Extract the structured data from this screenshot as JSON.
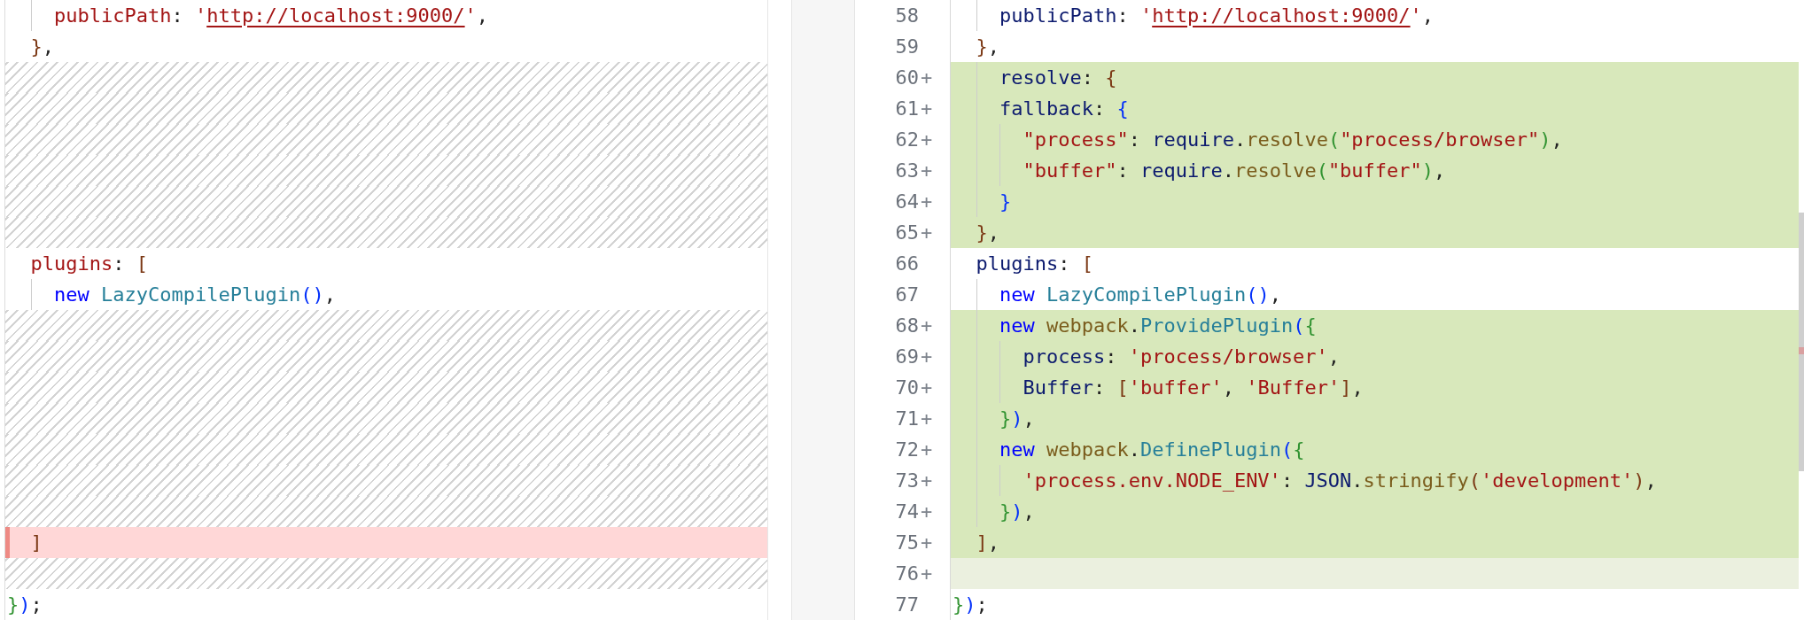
{
  "left_pane": {
    "lines": [
      {
        "kind": "code",
        "tokens": [
          {
            "kind": "name",
            "text": "    publicPath"
          },
          {
            "kind": "text",
            "text": ": "
          },
          {
            "kind": "string",
            "text": "'"
          },
          {
            "kind": "link",
            "text": "http://localhost:9000/"
          },
          {
            "kind": "string",
            "text": "'"
          },
          {
            "kind": "text",
            "text": ","
          }
        ]
      },
      {
        "kind": "code",
        "tokens": [
          {
            "kind": "brace1",
            "text": "  }"
          },
          {
            "kind": "text",
            "text": ","
          }
        ]
      },
      {
        "kind": "filler"
      },
      {
        "kind": "filler"
      },
      {
        "kind": "filler"
      },
      {
        "kind": "filler"
      },
      {
        "kind": "filler"
      },
      {
        "kind": "filler"
      },
      {
        "kind": "code",
        "tokens": [
          {
            "kind": "name",
            "text": "  plugins"
          },
          {
            "kind": "text",
            "text": ": "
          },
          {
            "kind": "brace1",
            "text": "["
          }
        ]
      },
      {
        "kind": "code",
        "tokens": [
          {
            "kind": "keyword",
            "text": "    new"
          },
          {
            "kind": "class",
            "text": " LazyCompilePlugin"
          },
          {
            "kind": "brace2",
            "text": "()"
          },
          {
            "kind": "text",
            "text": ","
          }
        ]
      },
      {
        "kind": "filler"
      },
      {
        "kind": "filler"
      },
      {
        "kind": "filler"
      },
      {
        "kind": "filler"
      },
      {
        "kind": "filler"
      },
      {
        "kind": "filler"
      },
      {
        "kind": "filler"
      },
      {
        "kind": "deleted",
        "tokens": [
          {
            "kind": "brace1",
            "text": "  ]"
          }
        ]
      },
      {
        "kind": "filler"
      },
      {
        "kind": "code",
        "tokens": [
          {
            "kind": "brace3",
            "text": "}"
          },
          {
            "kind": "brace2",
            "text": ")"
          },
          {
            "kind": "text",
            "text": ";"
          }
        ]
      }
    ]
  },
  "right_pane": {
    "lines": [
      {
        "number": "58",
        "kind": "context",
        "tokens": [
          {
            "kind": "ident",
            "text": "    publicPath"
          },
          {
            "kind": "text",
            "text": ": "
          },
          {
            "kind": "string",
            "text": "'"
          },
          {
            "kind": "link",
            "text": "http://localhost:9000/"
          },
          {
            "kind": "string",
            "text": "'"
          },
          {
            "kind": "text",
            "text": ","
          }
        ]
      },
      {
        "number": "59",
        "kind": "context",
        "tokens": [
          {
            "kind": "brace1",
            "text": "  }"
          },
          {
            "kind": "text",
            "text": ","
          }
        ]
      },
      {
        "number": "60",
        "marker": "+",
        "kind": "added",
        "tokens": [
          {
            "kind": "ident",
            "text": "    resolve"
          },
          {
            "kind": "text",
            "text": ": "
          },
          {
            "kind": "brace1",
            "text": "{"
          }
        ]
      },
      {
        "number": "61",
        "marker": "+",
        "kind": "added",
        "tokens": [
          {
            "kind": "ident",
            "text": "    fallback"
          },
          {
            "kind": "text",
            "text": ": "
          },
          {
            "kind": "brace2",
            "text": "{"
          }
        ]
      },
      {
        "number": "62",
        "marker": "+",
        "kind": "added",
        "tokens": [
          {
            "kind": "string",
            "text": "      \"process\""
          },
          {
            "kind": "text",
            "text": ": "
          },
          {
            "kind": "ident",
            "text": "require"
          },
          {
            "kind": "text",
            "text": "."
          },
          {
            "kind": "method",
            "text": "resolve"
          },
          {
            "kind": "brace3",
            "text": "("
          },
          {
            "kind": "string",
            "text": "\"process/browser\""
          },
          {
            "kind": "brace3",
            "text": ")"
          },
          {
            "kind": "text",
            "text": ","
          }
        ]
      },
      {
        "number": "63",
        "marker": "+",
        "kind": "added",
        "tokens": [
          {
            "kind": "string",
            "text": "      \"buffer\""
          },
          {
            "kind": "text",
            "text": ": "
          },
          {
            "kind": "ident",
            "text": "require"
          },
          {
            "kind": "text",
            "text": "."
          },
          {
            "kind": "method",
            "text": "resolve"
          },
          {
            "kind": "brace3",
            "text": "("
          },
          {
            "kind": "string",
            "text": "\"buffer\""
          },
          {
            "kind": "brace3",
            "text": ")"
          },
          {
            "kind": "text",
            "text": ","
          }
        ]
      },
      {
        "number": "64",
        "marker": "+",
        "kind": "added",
        "tokens": [
          {
            "kind": "brace2",
            "text": "    }"
          }
        ]
      },
      {
        "number": "65",
        "marker": "+",
        "kind": "added",
        "tokens": [
          {
            "kind": "brace1",
            "text": "  }"
          },
          {
            "kind": "text",
            "text": ","
          }
        ]
      },
      {
        "number": "66",
        "kind": "context",
        "tokens": [
          {
            "kind": "ident",
            "text": "  plugins"
          },
          {
            "kind": "text",
            "text": ": "
          },
          {
            "kind": "brace1",
            "text": "["
          }
        ]
      },
      {
        "number": "67",
        "kind": "context",
        "tokens": [
          {
            "kind": "keyword",
            "text": "    new"
          },
          {
            "kind": "class",
            "text": " LazyCompilePlugin"
          },
          {
            "kind": "brace2",
            "text": "()"
          },
          {
            "kind": "text",
            "text": ","
          }
        ]
      },
      {
        "number": "68",
        "marker": "+",
        "kind": "added",
        "tokens": [
          {
            "kind": "keyword",
            "text": "    new"
          },
          {
            "kind": "method",
            "text": " webpack"
          },
          {
            "kind": "text",
            "text": "."
          },
          {
            "kind": "class",
            "text": "ProvidePlugin"
          },
          {
            "kind": "brace2",
            "text": "("
          },
          {
            "kind": "brace3",
            "text": "{"
          }
        ]
      },
      {
        "number": "69",
        "marker": "+",
        "kind": "added",
        "tokens": [
          {
            "kind": "ident",
            "text": "      process"
          },
          {
            "kind": "text",
            "text": ": "
          },
          {
            "kind": "string",
            "text": "'process/browser'"
          },
          {
            "kind": "text",
            "text": ","
          }
        ]
      },
      {
        "number": "70",
        "marker": "+",
        "kind": "added",
        "tokens": [
          {
            "kind": "ident",
            "text": "      Buffer"
          },
          {
            "kind": "text",
            "text": ": "
          },
          {
            "kind": "brace1",
            "text": "["
          },
          {
            "kind": "string",
            "text": "'buffer'"
          },
          {
            "kind": "text",
            "text": ", "
          },
          {
            "kind": "string",
            "text": "'Buffer'"
          },
          {
            "kind": "brace1",
            "text": "]"
          },
          {
            "kind": "text",
            "text": ","
          }
        ]
      },
      {
        "number": "71",
        "marker": "+",
        "kind": "added",
        "tokens": [
          {
            "kind": "brace3",
            "text": "    }"
          },
          {
            "kind": "brace2",
            "text": ")"
          },
          {
            "kind": "text",
            "text": ","
          }
        ]
      },
      {
        "number": "72",
        "marker": "+",
        "kind": "added",
        "tokens": [
          {
            "kind": "keyword",
            "text": "    new"
          },
          {
            "kind": "method",
            "text": " webpack"
          },
          {
            "kind": "text",
            "text": "."
          },
          {
            "kind": "class",
            "text": "DefinePlugin"
          },
          {
            "kind": "brace2",
            "text": "("
          },
          {
            "kind": "brace3",
            "text": "{"
          }
        ]
      },
      {
        "number": "73",
        "marker": "+",
        "kind": "added",
        "tokens": [
          {
            "kind": "string",
            "text": "      'process.env.NODE_ENV'"
          },
          {
            "kind": "text",
            "text": ": "
          },
          {
            "kind": "ident",
            "text": "JSON"
          },
          {
            "kind": "text",
            "text": "."
          },
          {
            "kind": "method",
            "text": "stringify"
          },
          {
            "kind": "brace1",
            "text": "("
          },
          {
            "kind": "string",
            "text": "'development'"
          },
          {
            "kind": "brace1",
            "text": ")"
          },
          {
            "kind": "text",
            "text": ","
          }
        ]
      },
      {
        "number": "74",
        "marker": "+",
        "kind": "added",
        "tokens": [
          {
            "kind": "brace3",
            "text": "    }"
          },
          {
            "kind": "brace2",
            "text": ")"
          },
          {
            "kind": "text",
            "text": ","
          }
        ]
      },
      {
        "number": "75",
        "marker": "+",
        "kind": "added",
        "tokens": [
          {
            "kind": "brace1",
            "text": "  ]"
          },
          {
            "kind": "text",
            "text": ","
          }
        ]
      },
      {
        "number": "76",
        "marker": "+",
        "kind": "added",
        "current": true
      },
      {
        "number": "77",
        "kind": "context",
        "tokens": [
          {
            "kind": "brace3",
            "text": "}"
          },
          {
            "kind": "brace2",
            "text": ")"
          },
          {
            "kind": "text",
            "text": ";"
          }
        ]
      }
    ]
  }
}
